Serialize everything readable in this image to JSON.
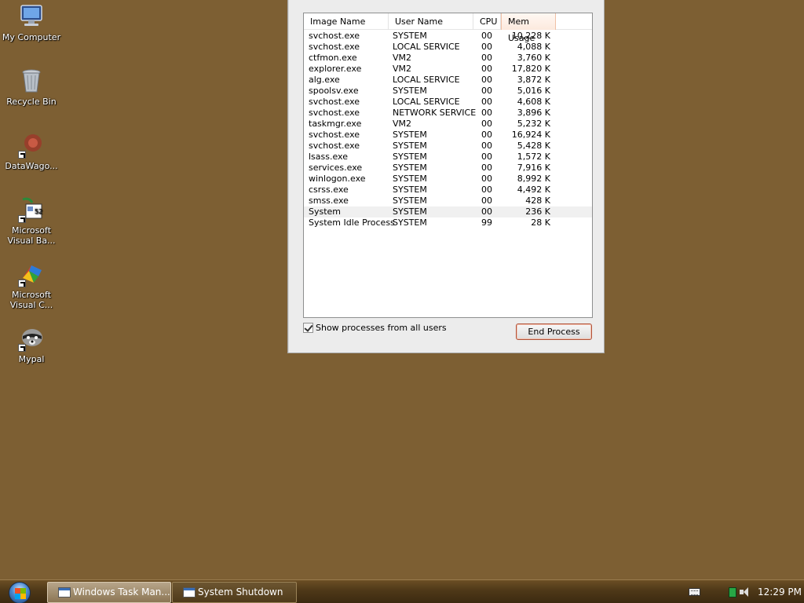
{
  "desktop": {
    "icons": [
      {
        "label": "My Computer",
        "icon": "computer-icon"
      },
      {
        "label": "Recycle Bin",
        "icon": "recycle-bin-icon"
      },
      {
        "label": "DataWago...",
        "icon": "datawagon-icon"
      },
      {
        "label": "Microsoft Visual Ba...",
        "icon": "visual-basic-icon"
      },
      {
        "label": "Microsoft Visual C...",
        "icon": "visual-c-icon"
      },
      {
        "label": "Mypal",
        "icon": "mypal-raccoon-icon"
      }
    ]
  },
  "task_manager": {
    "columns": {
      "image_name": "Image Name",
      "user_name": "User Name",
      "cpu": "CPU",
      "mem_usage": "Mem Usage"
    },
    "processes": [
      {
        "image": "svchost.exe",
        "user": "SYSTEM",
        "cpu": "00",
        "mem": "10,228 K"
      },
      {
        "image": "svchost.exe",
        "user": "LOCAL SERVICE",
        "cpu": "00",
        "mem": "4,088 K"
      },
      {
        "image": "ctfmon.exe",
        "user": "VM2",
        "cpu": "00",
        "mem": "3,760 K"
      },
      {
        "image": "explorer.exe",
        "user": "VM2",
        "cpu": "00",
        "mem": "17,820 K"
      },
      {
        "image": "alg.exe",
        "user": "LOCAL SERVICE",
        "cpu": "00",
        "mem": "3,872 K"
      },
      {
        "image": "spoolsv.exe",
        "user": "SYSTEM",
        "cpu": "00",
        "mem": "5,016 K"
      },
      {
        "image": "svchost.exe",
        "user": "LOCAL SERVICE",
        "cpu": "00",
        "mem": "4,608 K"
      },
      {
        "image": "svchost.exe",
        "user": "NETWORK SERVICE",
        "cpu": "00",
        "mem": "3,896 K"
      },
      {
        "image": "taskmgr.exe",
        "user": "VM2",
        "cpu": "00",
        "mem": "5,232 K"
      },
      {
        "image": "svchost.exe",
        "user": "SYSTEM",
        "cpu": "00",
        "mem": "16,924 K"
      },
      {
        "image": "svchost.exe",
        "user": "SYSTEM",
        "cpu": "00",
        "mem": "5,428 K"
      },
      {
        "image": "lsass.exe",
        "user": "SYSTEM",
        "cpu": "00",
        "mem": "1,572 K"
      },
      {
        "image": "services.exe",
        "user": "SYSTEM",
        "cpu": "00",
        "mem": "7,916 K"
      },
      {
        "image": "winlogon.exe",
        "user": "SYSTEM",
        "cpu": "00",
        "mem": "8,992 K"
      },
      {
        "image": "csrss.exe",
        "user": "SYSTEM",
        "cpu": "00",
        "mem": "4,492 K"
      },
      {
        "image": "smss.exe",
        "user": "SYSTEM",
        "cpu": "00",
        "mem": "428 K"
      },
      {
        "image": "System",
        "user": "SYSTEM",
        "cpu": "00",
        "mem": "236 K"
      },
      {
        "image": "System Idle Process",
        "user": "SYSTEM",
        "cpu": "99",
        "mem": "28 K"
      }
    ],
    "show_all_users_label": "Show processes from all users",
    "show_all_users_checked": true,
    "end_process_label": "End Process"
  },
  "taskbar": {
    "buttons": [
      {
        "label": "Windows Task Man...",
        "active": true,
        "icon": "task-manager-icon"
      },
      {
        "label": "System Shutdown",
        "active": false,
        "icon": "window-icon"
      }
    ],
    "clock": "12:29 PM"
  }
}
